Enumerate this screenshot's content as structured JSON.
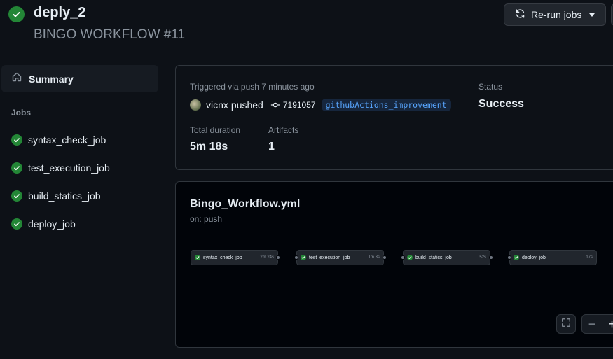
{
  "header": {
    "title": "deply_2",
    "subtitle": "BINGO WORKFLOW #11",
    "rerun_label": "Re-run jobs"
  },
  "sidebar": {
    "summary_label": "Summary",
    "jobs_heading": "Jobs",
    "jobs": [
      {
        "name": "syntax_check_job"
      },
      {
        "name": "test_execution_job"
      },
      {
        "name": "build_statics_job"
      },
      {
        "name": "deploy_job"
      }
    ]
  },
  "summary": {
    "triggered_text": "Triggered via push 7 minutes ago",
    "actor": "vicnx",
    "action": "pushed",
    "commit_sha": "7191057",
    "branch": "githubActions_improvement",
    "status_label": "Status",
    "status_value": "Success",
    "duration_label": "Total duration",
    "duration_value": "5m 18s",
    "artifacts_label": "Artifacts",
    "artifacts_value": "1"
  },
  "workflow": {
    "file": "Bingo_Workflow.yml",
    "trigger": "on: push",
    "nodes": [
      {
        "name": "syntax_check_job",
        "duration": "2m 24s"
      },
      {
        "name": "test_execution_job",
        "duration": "1m 3s"
      },
      {
        "name": "build_statics_job",
        "duration": "52s"
      },
      {
        "name": "deploy_job",
        "duration": "17s"
      }
    ],
    "zoom_out": "−",
    "zoom_in": "+"
  },
  "colors": {
    "success": "#238636",
    "background": "#0d1117",
    "link": "#58a6ff"
  },
  "icons": {
    "status": "check-circle-icon",
    "rerun": "sync-icon",
    "summary": "home-icon",
    "commit": "git-commit-icon",
    "fullscreen": "fullscreen-icon"
  }
}
